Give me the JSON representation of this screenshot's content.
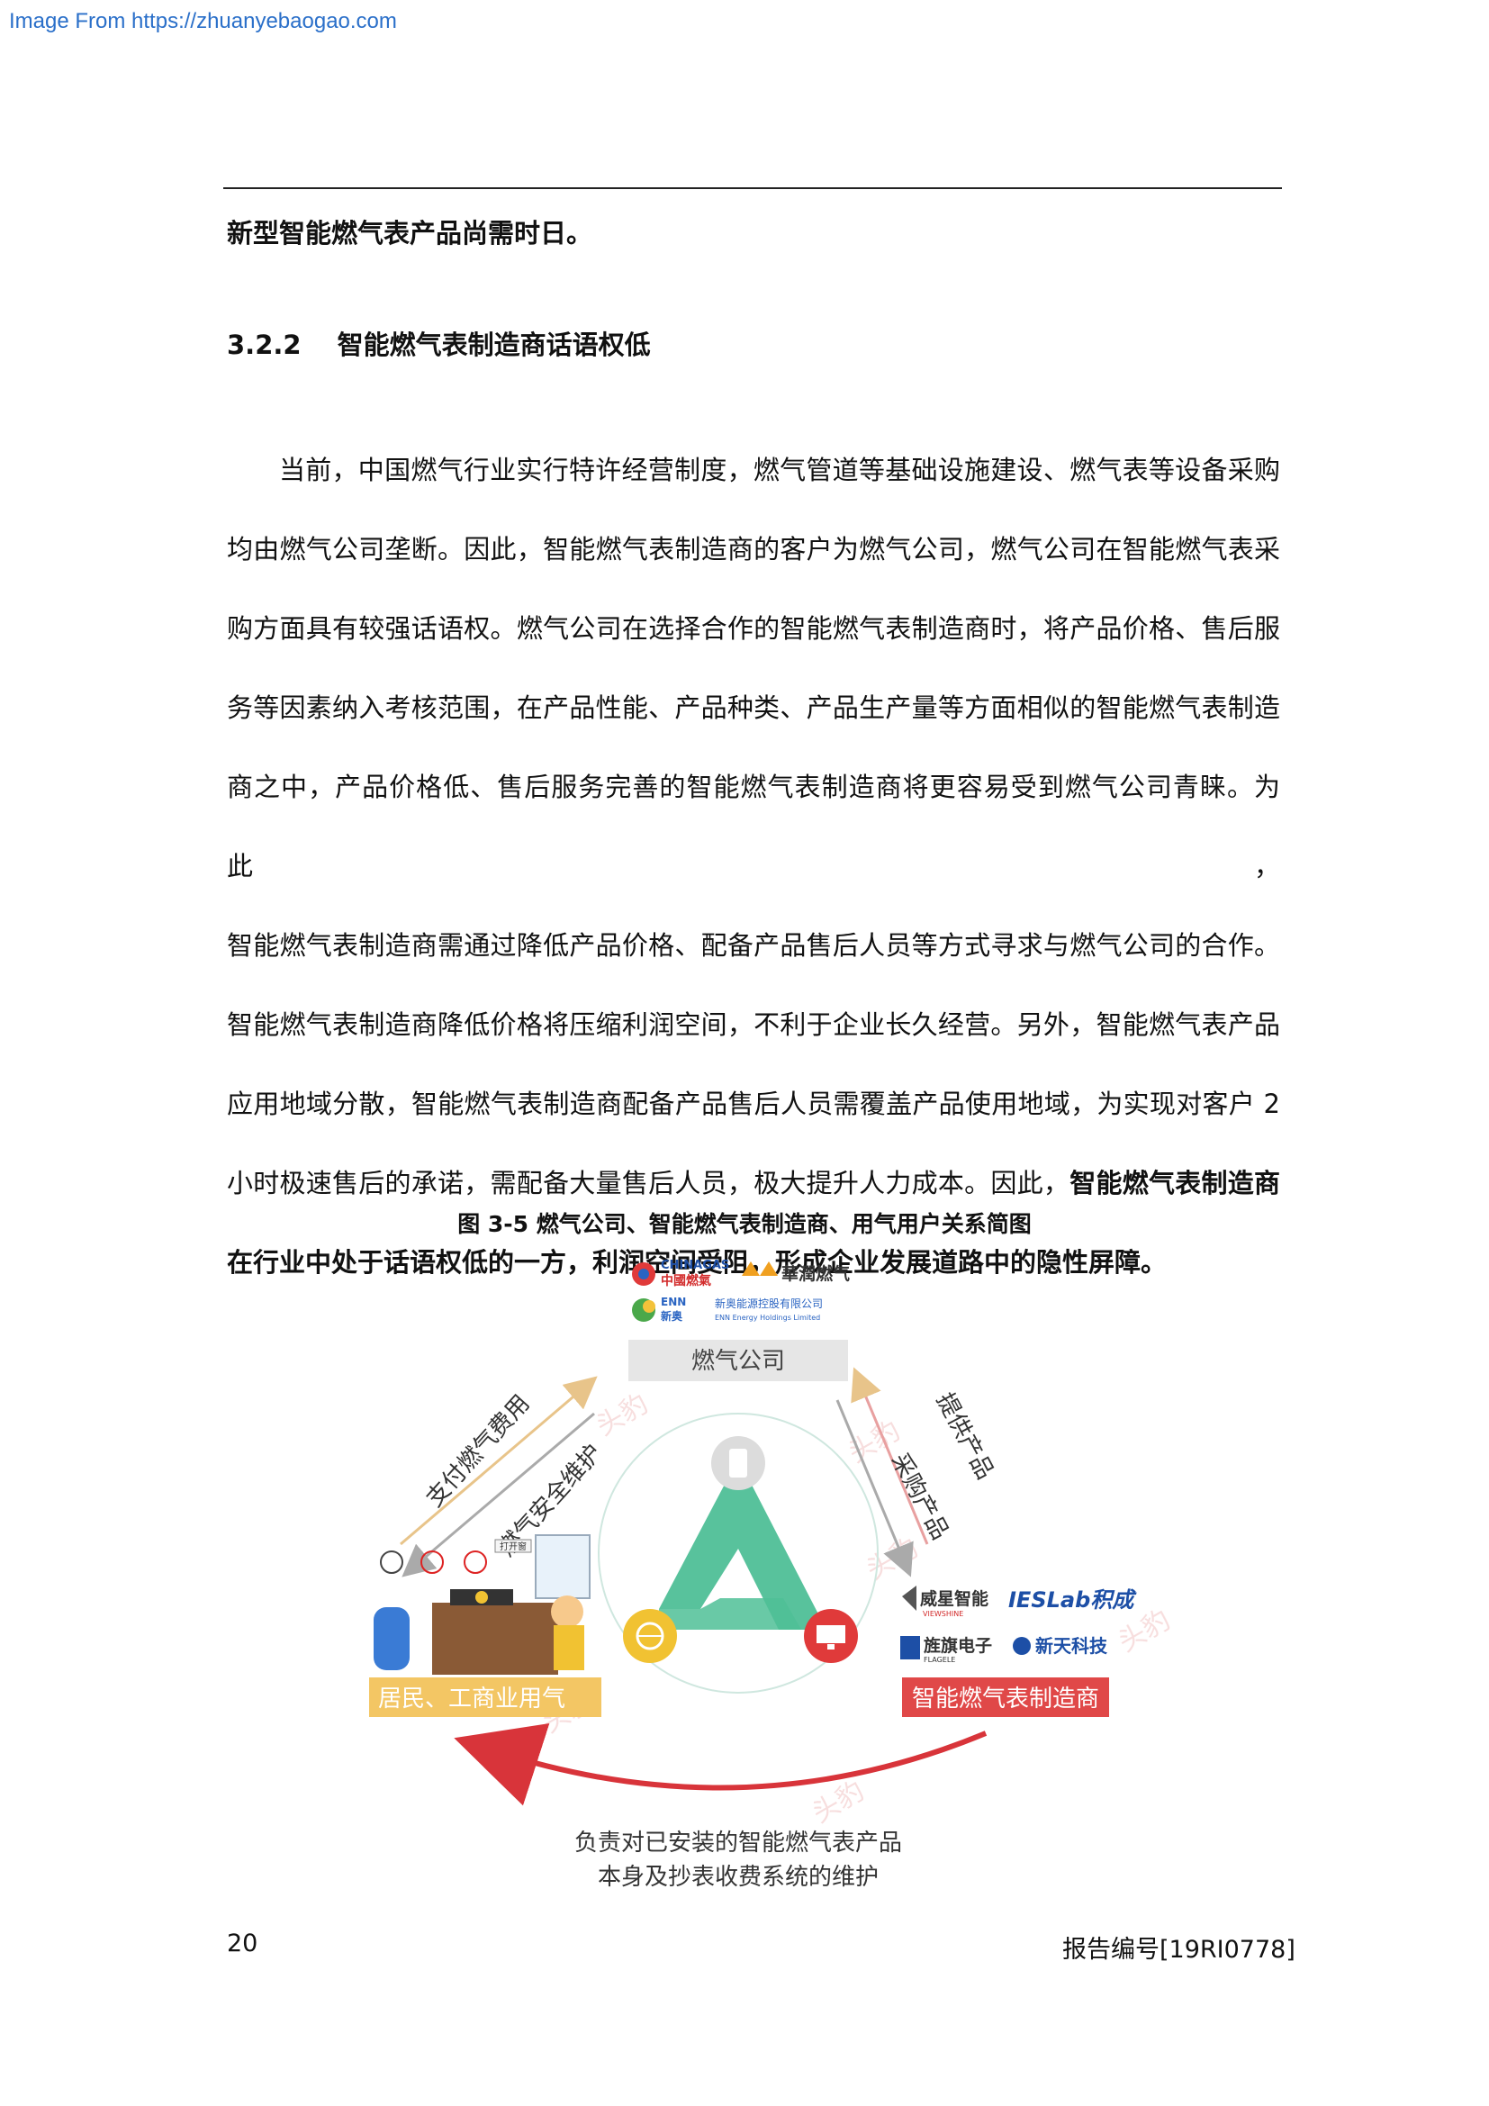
{
  "source_link": "Image From https://zhuanyebaogao.com",
  "lead_line": "新型智能燃气表产品尚需时日。",
  "section": {
    "number": "3.2.2",
    "title": "智能燃气表制造商话语权低"
  },
  "paragraph_lines": [
    "当前，中国燃气行业实行特许经营制度，燃气管道等基础设施建设、燃气表等设备采购",
    "均由燃气公司垄断。因此，智能燃气表制造商的客户为燃气公司，燃气公司在智能燃气表采",
    "购方面具有较强话语权。燃气公司在选择合作的智能燃气表制造商时，将产品价格、售后服",
    "务等因素纳入考核范围，在产品性能、产品种类、产品生产量等方面相似的智能燃气表制造",
    "商之中，产品价格低、售后服务完善的智能燃气表制造商将更容易受到燃气公司青睐。为此，",
    "智能燃气表制造商需通过降低产品价格、配备产品售后人员等方式寻求与燃气公司的合作。",
    "智能燃气表制造商降低价格将压缩利润空间，不利于企业长久经营。另外，智能燃气表产品",
    "应用地域分散，智能燃气表制造商配备产品售后人员需覆盖产品使用地域，为实现对客户 2"
  ],
  "paragraph_line9_normal": "小时极速售后的承诺，需配备大量售后人员，极大提升人力成本。因此，",
  "paragraph_line9_bold": "智能燃气表制造商",
  "paragraph_line10_bold": "在行业中处于话语权低的一方，利润空间受阻，形成企业发展道路中的隐性屏障。",
  "figure": {
    "caption": "图 3-5 燃气公司、智能燃气表制造商、用气用户关系简图",
    "gas_company": {
      "label": "燃气公司",
      "logo_chinagas_en": "CHINAGAS",
      "logo_chinagas_cn": "中國燃氣",
      "logo_huarun": "華潤燃气",
      "logo_enn_en": "ENN",
      "logo_enn_cn": "新奥",
      "logo_enn_name_cn": "新奥能源控股有限公司",
      "logo_enn_name_en": "ENN Energy Holdings Limited"
    },
    "manufacturer": {
      "label": "智能燃气表制造商",
      "logo_viewshine_cn": "威星智能",
      "logo_viewshine_en": "VIEWSHINE",
      "logo_ieslab": "IESLab积成",
      "logo_flagele_cn": "旌旗电子",
      "logo_flagele_en": "FLAGELE",
      "logo_xintian": "新天科技"
    },
    "users": {
      "label": "居民、工商业用气",
      "window_sign": "打开窗"
    },
    "arrows": {
      "pay_fee": "支付燃气费用",
      "safety_maintenance": "燃气安全维护",
      "provide_products": "提供产品",
      "purchase_products": "采购产品",
      "bottom_line1": "负责对已安装的智能燃气表产品",
      "bottom_line2": "本身及抄表收费系统的维护"
    },
    "watermark": "头豹"
  },
  "footer": {
    "page_number": "20",
    "report_id": "报告编号[19RI0778]"
  }
}
